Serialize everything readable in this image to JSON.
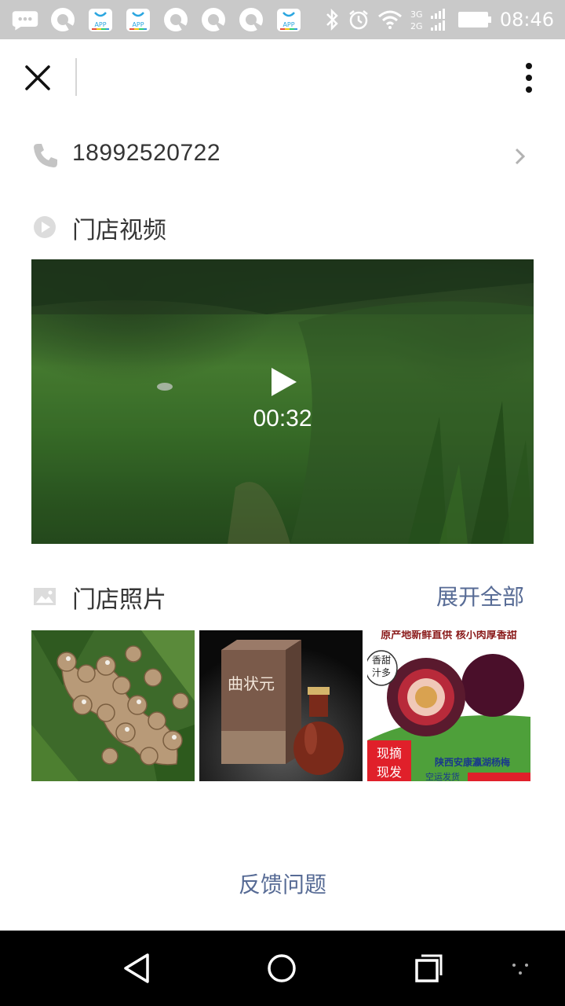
{
  "status_bar": {
    "time": "08:46",
    "network_labels": [
      "3G",
      "2G"
    ],
    "app_badge_label": "APP"
  },
  "header": {
    "close_icon": "close-icon",
    "more_icon": "more-vert-icon"
  },
  "contact": {
    "phone_number": "18992520722"
  },
  "video_section": {
    "title": "门店视频",
    "duration": "00:32"
  },
  "photos_section": {
    "title": "门店照片",
    "expand_label": "展开全部",
    "photos": [
      {
        "name": "loquat-photo"
      },
      {
        "name": "liquor-photo",
        "brand_text": "曲状元"
      },
      {
        "name": "bayberry-photo",
        "top_text": "原产地新鲜直供 核小肉厚香甜",
        "bubble_text_1": "香甜",
        "bubble_text_2": "汁多",
        "tag_1": "现摘",
        "tag_2": "现发",
        "bottom_text": "陕西安康瀛湖杨梅",
        "bottom_text_2": "空运发货"
      }
    ]
  },
  "footer": {
    "feedback_label": "反馈问题"
  },
  "colors": {
    "link": "#576b95",
    "status_bar": "#c9c9c9",
    "nav_bar": "#000000"
  }
}
